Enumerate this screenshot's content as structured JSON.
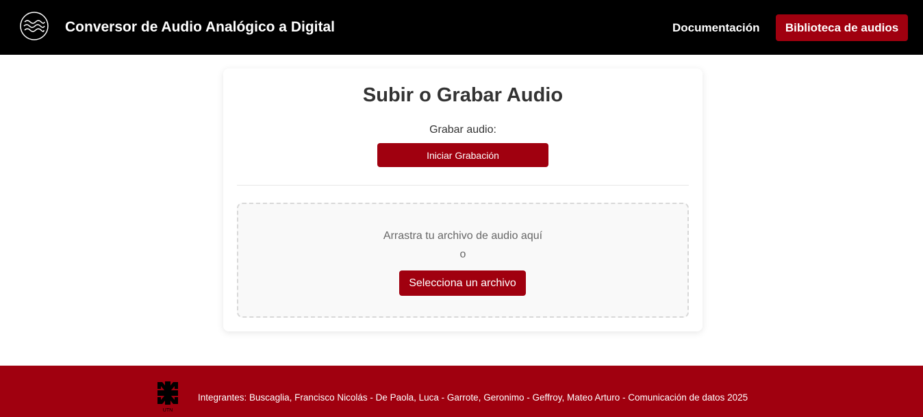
{
  "header": {
    "logo_icon": "sound-waves-icon",
    "title": "Conversor de Audio Analógico a Digital",
    "nav_documentation": "Documentación",
    "nav_library": "Biblioteca de audios"
  },
  "card": {
    "title": "Subir o Grabar Audio",
    "record_label": "Grabar audio:",
    "record_button": "Iniciar Grabación",
    "dropzone": {
      "text": "Arrastra tu archivo de audio aquí",
      "or": "o",
      "select_button": "Selecciona un archivo"
    }
  },
  "footer": {
    "logo_icon": "utn-logo-icon",
    "logo_text": "UTN",
    "text": "Integrantes: Buscaglia, Francisco Nicolás - De Paola, Luca - Garrote, Geronimo - Geffroy, Mateo Arturo - Comunicación de datos 2025"
  },
  "colors": {
    "header_bg": "#000000",
    "accent": "#a0000f",
    "card_bg": "#ffffff",
    "dropzone_bg": "#f9f9f9"
  }
}
